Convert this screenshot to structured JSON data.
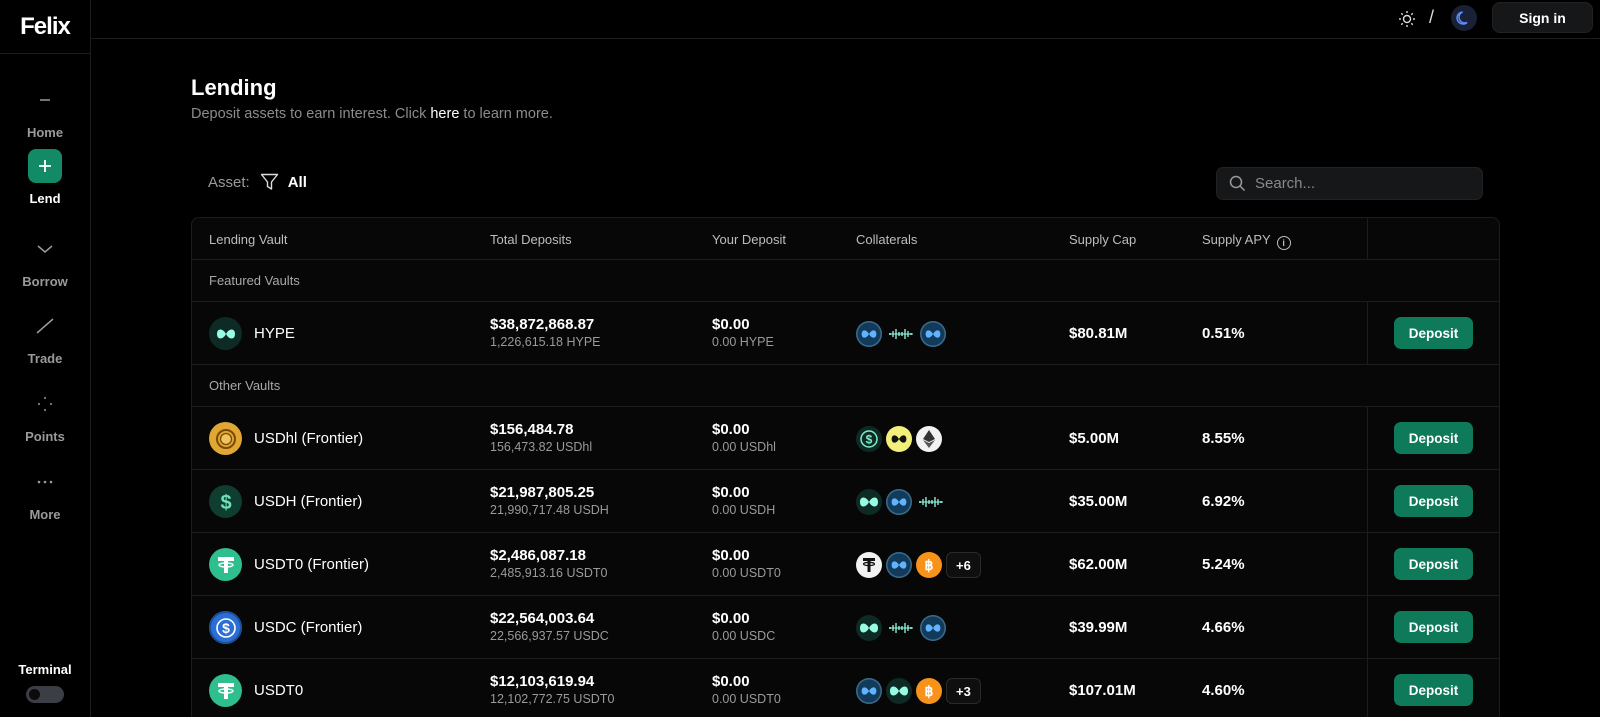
{
  "brand": {
    "logo": "Felix"
  },
  "sidebar": {
    "items": [
      {
        "label": "Home",
        "icon": "minus-icon",
        "active": false
      },
      {
        "label": "Lend",
        "icon": "plus-icon",
        "active": true
      },
      {
        "label": "Borrow",
        "icon": "chevron-down-icon",
        "active": false
      },
      {
        "label": "Trade",
        "icon": "trade-line-icon",
        "active": false
      },
      {
        "label": "Points",
        "icon": "dots-cross-icon",
        "active": false
      },
      {
        "label": "More",
        "icon": "ellipsis-icon",
        "active": false
      }
    ],
    "terminal_label": "Terminal"
  },
  "topbar": {
    "separator": "/",
    "signin_label": "Sign in"
  },
  "header": {
    "title": "Lending",
    "subtitle_prefix": "Deposit assets to earn interest. Click ",
    "subtitle_link": "here",
    "subtitle_suffix": " to learn more."
  },
  "filter": {
    "label": "Asset:",
    "value": "All"
  },
  "search": {
    "placeholder": "Search..."
  },
  "table": {
    "columns": [
      "Lending Vault",
      "Total Deposits",
      "Your Deposit",
      "Collaterals",
      "Supply Cap",
      "Supply APY"
    ],
    "featured_label": "Featured Vaults",
    "other_label": "Other Vaults",
    "deposit_label": "Deposit",
    "featured": [
      {
        "name": "HYPE",
        "icon": "hype-icon",
        "total": "$38,872,868.87",
        "total_sub": "1,226,615.18 HYPE",
        "yours": "$0.00",
        "yours_sub": "0.00 HYPE",
        "collaterals": [
          "khype-icon",
          "wave-icon",
          "khype-icon"
        ],
        "more": "",
        "cap": "$80.81M",
        "apy": "0.51%"
      }
    ],
    "other": [
      {
        "name": "USDhl (Frontier)",
        "icon": "usdhl-icon",
        "total": "$156,484.78",
        "total_sub": "156,473.82 USDhl",
        "yours": "$0.00",
        "yours_sub": "0.00 USDhl",
        "collaterals": [
          "dollar-coin-icon",
          "yellow-hype-icon",
          "ethereum-icon"
        ],
        "more": "",
        "cap": "$5.00M",
        "apy": "8.55%"
      },
      {
        "name": "USDH (Frontier)",
        "icon": "usdh-icon",
        "total": "$21,987,805.25",
        "total_sub": "21,990,717.48 USDH",
        "yours": "$0.00",
        "yours_sub": "0.00 USDH",
        "collaterals": [
          "hype-icon",
          "khype-icon",
          "wave-icon"
        ],
        "more": "",
        "cap": "$35.00M",
        "apy": "6.92%"
      },
      {
        "name": "USDT0 (Frontier)",
        "icon": "usdt0-icon",
        "total": "$2,486,087.18",
        "total_sub": "2,485,913.16 USDT0",
        "yours": "$0.00",
        "yours_sub": "0.00 USDT0",
        "collaterals": [
          "tether-icon",
          "khype-icon",
          "bitcoin-icon"
        ],
        "more": "+6",
        "cap": "$62.00M",
        "apy": "5.24%"
      },
      {
        "name": "USDC (Frontier)",
        "icon": "usdc-icon",
        "total": "$22,564,003.64",
        "total_sub": "22,566,937.57 USDC",
        "yours": "$0.00",
        "yours_sub": "0.00 USDC",
        "collaterals": [
          "hype-icon",
          "wave-icon",
          "khype-icon"
        ],
        "more": "",
        "cap": "$39.99M",
        "apy": "4.66%"
      },
      {
        "name": "USDT0",
        "icon": "usdt0-icon",
        "total": "$12,103,619.94",
        "total_sub": "12,102,772.75 USDT0",
        "yours": "$0.00",
        "yours_sub": "0.00 USDT0",
        "collaterals": [
          "khype-icon",
          "hype-icon",
          "bitcoin-icon"
        ],
        "more": "+3",
        "cap": "$107.01M",
        "apy": "4.60%"
      }
    ]
  },
  "colors": {
    "accent": "#0f7a59",
    "active_nav": "#138a66",
    "background": "#000000",
    "hype_mint": "#97fce4"
  }
}
